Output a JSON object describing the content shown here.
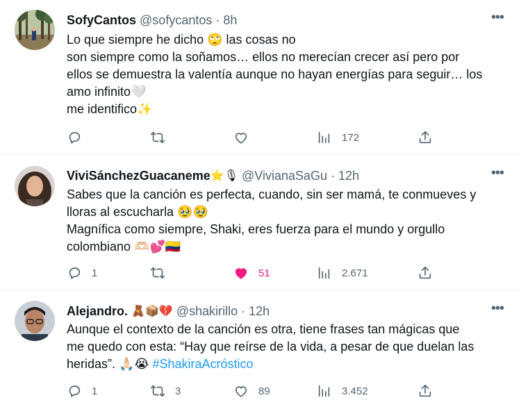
{
  "tweets": [
    {
      "name": "SofyCantos",
      "handle": "@sofycantos",
      "time": "8h",
      "lines": [
        "Lo que siempre he dicho 🙄 las cosas no",
        "son siempre como la soñamos… ellos no merecían crecer así pero por",
        "ellos se demuestra la valentía aunque no hayan energías para seguir… los",
        "amo infinito🤍",
        "me identifico✨"
      ],
      "replies": "",
      "retweets": "",
      "likes": "",
      "views": "172",
      "liked": false
    },
    {
      "name": "ViviSánchezGuacaneme",
      "name_emoji": "⭐🎙",
      "handle": "@VivianaSaGu",
      "time": "12h",
      "lines": [
        "Sabes que la canción es perfecta, cuando, sin ser mamá, te conmueves y",
        "lloras al escucharla 🥹🥹",
        "Magnífica como siempre, Shaki, eres fuerza para el mundo y orgullo",
        "colombiano 🫶🏻💕🇨🇴"
      ],
      "replies": "1",
      "retweets": "",
      "likes": "51",
      "views": "2.671",
      "liked": true
    },
    {
      "name": "Alejandro.",
      "name_emoji": "🧸📦💔",
      "handle": "@shakirillo",
      "time": "12h",
      "lines": [
        "Aunque el contexto de la canción es otra, tiene frases tan mágicas que",
        "me quedo con esta: “Hay que reírse de la vida, a pesar de que duelan las",
        "heridas”. 🙏🏻😭 "
      ],
      "hashtag": "#ShakiraAcróstico",
      "replies": "1",
      "retweets": "3",
      "likes": "89",
      "views": "3.452",
      "liked": false
    }
  ],
  "separator": " · ",
  "more_label": "•••",
  "colors": {
    "text": "#0f1419",
    "secondary": "#536471",
    "link": "#1d9bf0",
    "like_active": "#f91880"
  },
  "icons": [
    "reply-icon",
    "retweet-icon",
    "like-icon",
    "views-icon",
    "share-icon",
    "more-icon"
  ]
}
